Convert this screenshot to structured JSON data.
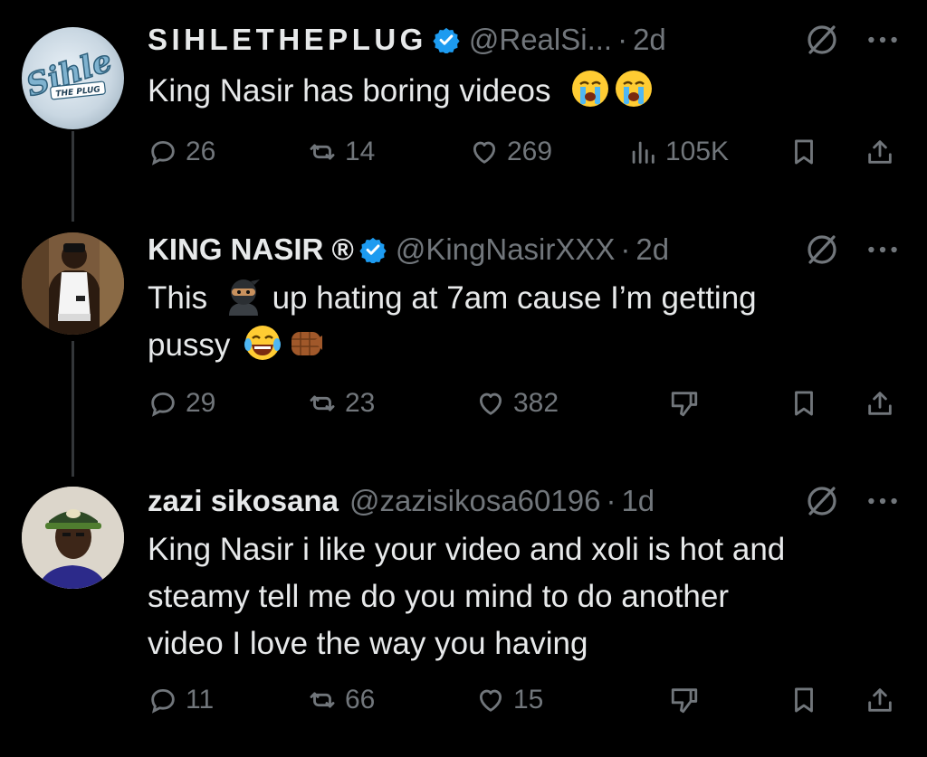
{
  "tweets": [
    {
      "author": "SIHLETHEPLUG",
      "handle": "@RealSi...",
      "dot": "·",
      "time": "2d",
      "avatar_text": {
        "line1": "Sihle",
        "line2": "THE PLUG"
      },
      "text": "King Nasir has boring videos",
      "emojis": [
        "loudly-crying-face",
        "loudly-crying-face"
      ],
      "stats": {
        "replies": "26",
        "reposts": "14",
        "likes": "269",
        "views": "105K"
      }
    },
    {
      "author": "KING NASIR ®",
      "handle": "@KingNasirXXX",
      "dot": "·",
      "time": "2d",
      "text_parts": [
        "This",
        " up hating at 7am cause I’m getting",
        "pussy"
      ],
      "emojis": [
        "ninja",
        "face-with-tears-of-joy",
        "oncoming-fist"
      ],
      "stats": {
        "replies": "29",
        "reposts": "23",
        "likes": "382"
      }
    },
    {
      "author": "zazi sikosana",
      "handle": "@zazisikosa60196",
      "dot": "·",
      "time": "1d",
      "text_lines": [
        "King Nasir i like your video and xoli is hot and",
        "steamy tell me do you mind to do another",
        "video I love the way you having"
      ],
      "stats": {
        "replies": "11",
        "reposts": "66",
        "likes": "15"
      }
    }
  ],
  "colors": {
    "background": "#000000",
    "text": "#e7e9ea",
    "muted": "#71767b",
    "verified": "#1d9bf0",
    "thread_line": "#333639"
  }
}
